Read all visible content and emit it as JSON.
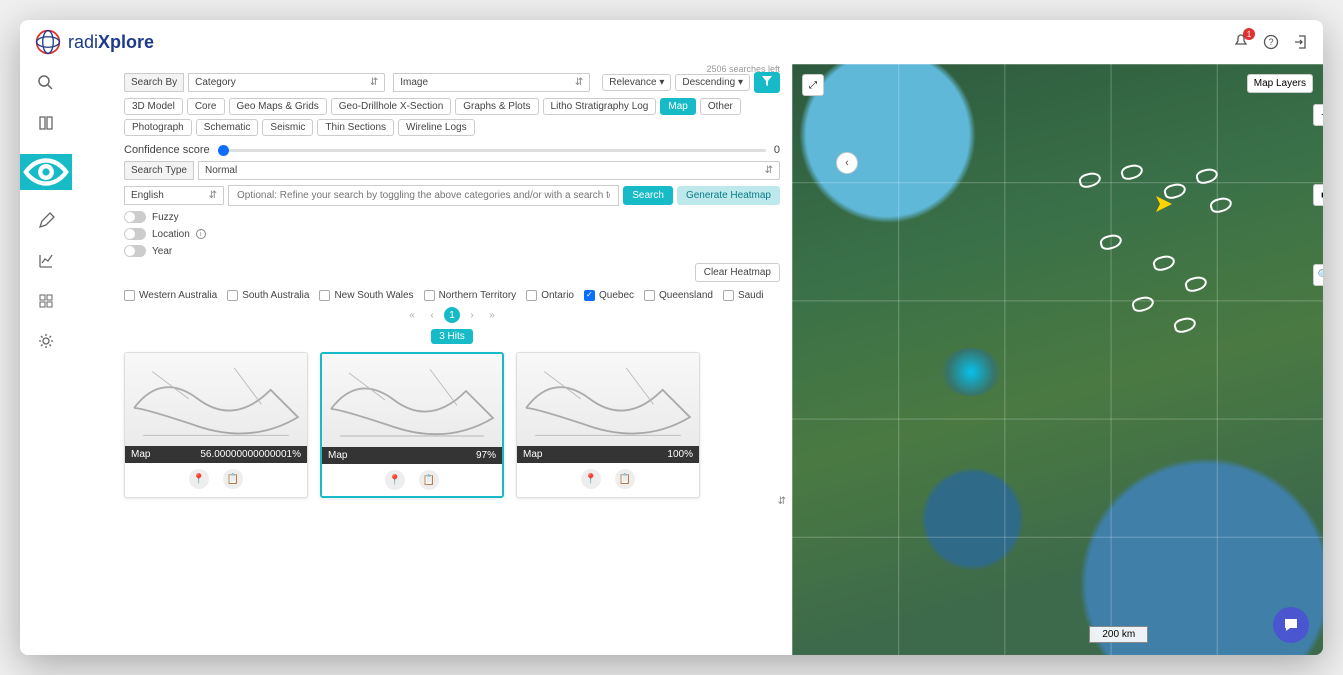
{
  "header": {
    "brand_left": "radi",
    "brand_right": "Xplore",
    "notification_count": "1"
  },
  "sidebar": {
    "items": [
      "search",
      "book",
      "eye",
      "pencil",
      "chart",
      "grid",
      "gear"
    ]
  },
  "search": {
    "searches_left": "2506 searches left",
    "search_by_label": "Search By",
    "search_by_value": "Category",
    "image_label": "Image",
    "relevance": "Relevance",
    "order": "Descending",
    "confidence_label": "Confidence score",
    "confidence_value": "0",
    "search_type_label": "Search Type",
    "search_type_value": "Normal",
    "language": "English",
    "placeholder": "Optional: Refine your search by toggling the above categories and/or with a search term.",
    "search_btn": "Search",
    "generate_btn": "Generate Heatmap",
    "clear_btn": "Clear Heatmap",
    "tags": [
      "3D Model",
      "Core",
      "Geo Maps & Grids",
      "Geo-Drillhole X-Section",
      "Graphs & Plots",
      "Litho Stratigraphy Log",
      "Map",
      "Other",
      "Photograph",
      "Schematic",
      "Seismic",
      "Thin Sections",
      "Wireline Logs"
    ],
    "active_tag": "Map",
    "toggles": [
      {
        "label": "Fuzzy"
      },
      {
        "label": "Location",
        "info": true
      },
      {
        "label": "Year"
      }
    ],
    "regions": [
      {
        "label": "Western Australia",
        "checked": false
      },
      {
        "label": "South Australia",
        "checked": false
      },
      {
        "label": "New South Wales",
        "checked": false
      },
      {
        "label": "Northern Territory",
        "checked": false
      },
      {
        "label": "Ontario",
        "checked": false
      },
      {
        "label": "Quebec",
        "checked": true
      },
      {
        "label": "Queensland",
        "checked": false
      },
      {
        "label": "Saudi",
        "checked": false
      }
    ],
    "pager": {
      "first": "«",
      "prev": "‹",
      "current": "1",
      "next": "›",
      "last": "»"
    },
    "hits": "3 Hits"
  },
  "results": [
    {
      "type": "Map",
      "conf": "56.00000000000001%"
    },
    {
      "type": "Map",
      "conf": "97%",
      "selected": true
    },
    {
      "type": "Map",
      "conf": "100%"
    }
  ],
  "map": {
    "layers_btn": "Map Layers",
    "scale": "200 km"
  }
}
